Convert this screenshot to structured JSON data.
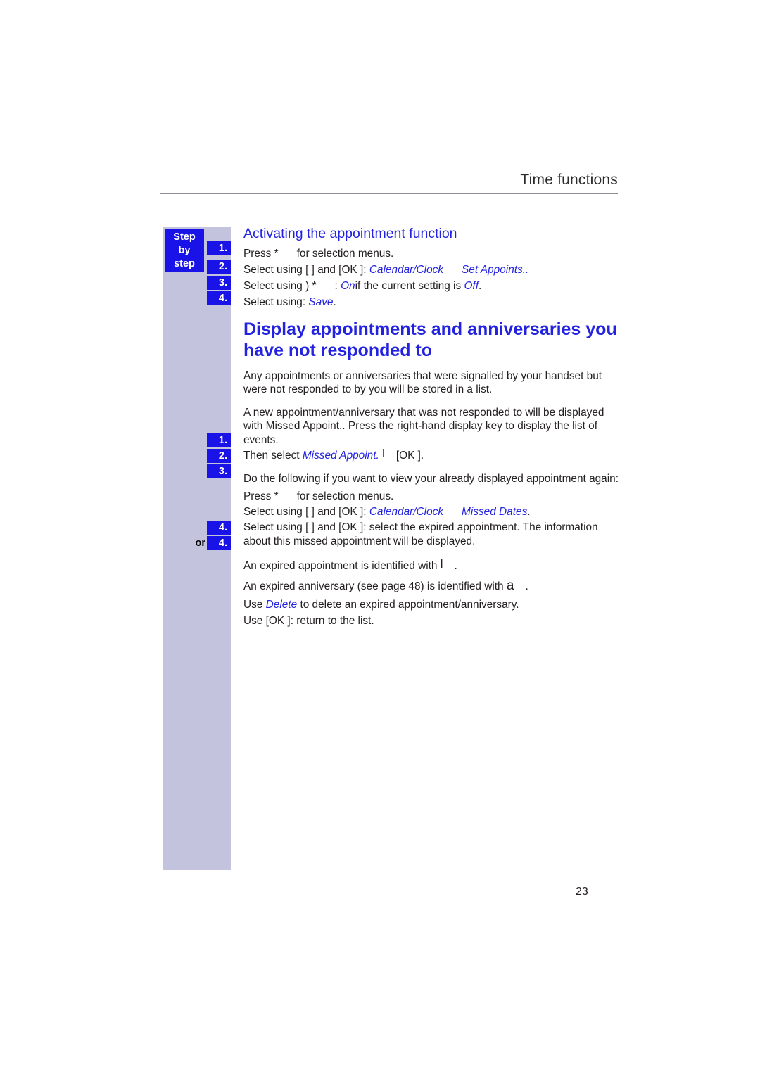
{
  "header": {
    "title": "Time functions"
  },
  "sidebar": {
    "label_line1": "Step",
    "label_line2": "by",
    "label_line3": "step",
    "or_label": "or",
    "badges": [
      "1.",
      "2.",
      "3.",
      "4.",
      "1.",
      "2.",
      "3.",
      "4.",
      "4."
    ]
  },
  "sections": {
    "sub_heading": "Activating the appointment function",
    "main_heading": "Display appointments and anniversaries you have not responded to"
  },
  "steps_group_1": [
    {
      "num": "1.",
      "text_a": "Press *",
      "text_b": "for selection menus."
    },
    {
      "num": "2.",
      "text_a": "Select using [   ] and [OK ]:",
      "em_a": "Calendar/Clock",
      "em_b": "Set Appoints.."
    },
    {
      "num": "3.",
      "text_a": "Select using ) *",
      "text_b": ":",
      "em_a": "On",
      "text_c": "if the current setting is",
      "em_b": "Off",
      "text_d": "."
    },
    {
      "num": "4.",
      "text_a": "Select using:",
      "em_a": "Save",
      "text_b": "."
    }
  ],
  "paragraphs": {
    "p1": "Any appointments or anniversaries that were signalled by your handset but were not responded to by you will be stored in a list.",
    "p2": "A new appointment/anniversary that was not responded to will be displayed with   Missed Appoint.. Press the right-hand display key to display the list of events.",
    "p3_prefix": "Then select",
    "p3_em": "Missed Appoint.",
    "p3_glyph": "l",
    "p3_suffix": "[OK ].",
    "p4": "Do the following if you want to view your already displayed appointment again:",
    "p5_prefix": "An expired appointment is identified with",
    "p5_glyph": "l",
    "p5_suffix": ".",
    "p6_prefix": "An expired anniversary (see page 48) is identified with",
    "p6_glyph": "a",
    "p6_suffix": "."
  },
  "steps_group_2": [
    {
      "num": "1.",
      "text_a": "Press *",
      "text_b": "for selection menus."
    },
    {
      "num": "2.",
      "text_a": "Select using [   ] and [OK ]:",
      "em_a": "Calendar/Clock",
      "em_b": "Missed Dates",
      "text_b": "."
    },
    {
      "num": "3.",
      "text_a": "Select using [   ] and [OK ]: select the expired appointment. The information about this missed appointment will be displayed."
    },
    {
      "num": "4.",
      "text_a": "Use",
      "em_a": "Delete",
      "text_b": "to delete an expired appointment/anniversary."
    },
    {
      "num": "4.",
      "text_a": "Use [OK ]: return to the list."
    }
  ],
  "footer": {
    "page_number": "23"
  }
}
